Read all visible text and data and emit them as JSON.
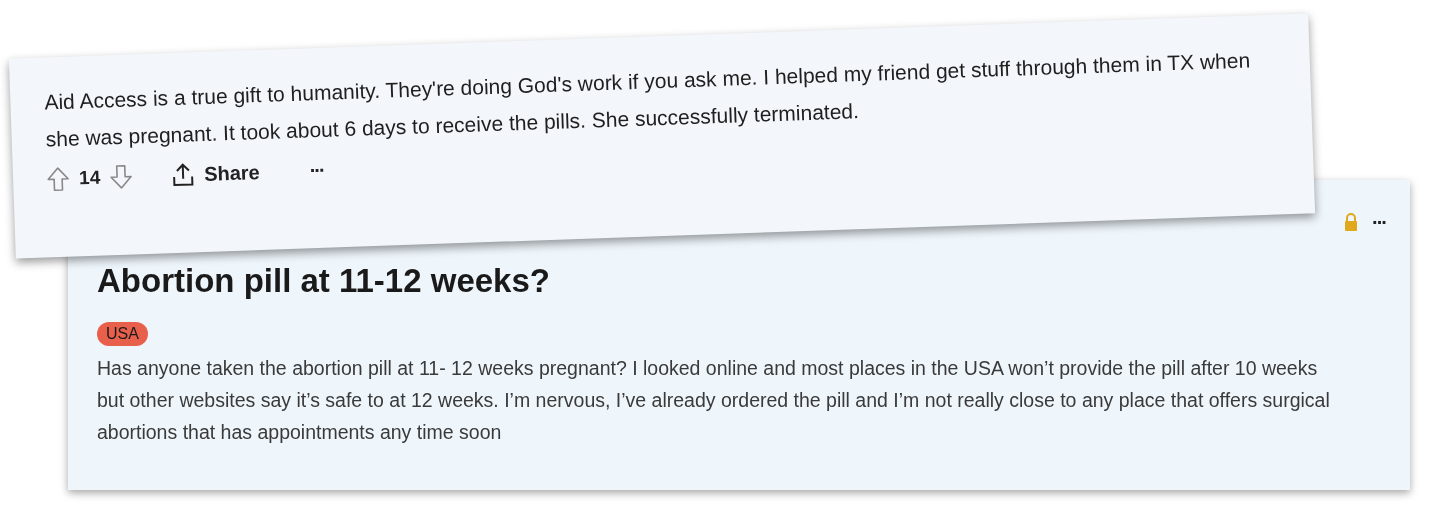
{
  "comment": {
    "text": "Aid Access is a true gift to humanity. They're doing God's work if you ask me. I helped my friend get stuff through them in TX when she was pregnant. It took about 6 days to receive the pills. She successfully terminated.",
    "score": "14",
    "share_label": "Share",
    "more": "···"
  },
  "post": {
    "locked": true,
    "more": "···",
    "title": "Abortion pill at 11-12 weeks?",
    "flair": "USA",
    "body": "Has anyone taken the abortion pill at 11- 12 weeks pregnant? I looked online and most places in the USA won’t provide the pill after 10 weeks but other websites say it’s safe to at 12 weeks. I’m nervous, I’ve already ordered the pill and I’m not really close to any place that offers surgical abortions that has appointments any time soon"
  }
}
